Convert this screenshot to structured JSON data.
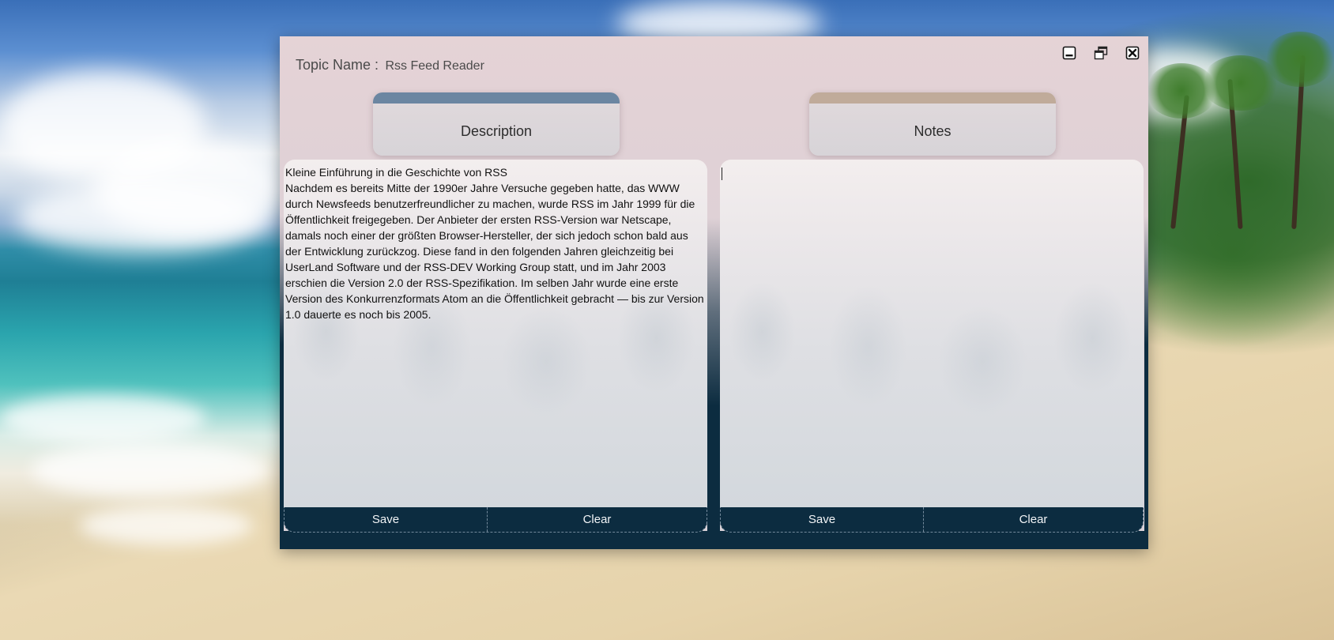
{
  "window": {
    "topic_label": "Topic Name :",
    "topic_value": "Rss Feed Reader",
    "controls": {
      "minimize_icon": "minimize-icon",
      "restore_icon": "restore-icon",
      "close_icon": "close-icon"
    }
  },
  "description": {
    "header": "Description",
    "text_lines": [
      "Kleine Einführung in die Geschichte von RSS",
      "Nachdem es bereits Mitte der 1990er Jahre Versuche gegeben hatte, das WWW durch Newsfeeds benutzerfreundlicher zu machen, wurde RSS im Jahr 1999 für die Öffentlichkeit freigegeben. Der Anbieter der ersten RSS-Version war Netscape, damals noch einer der größten Browser-Hersteller, der sich jedoch schon bald aus der Entwicklung zurückzog. Diese fand in den folgenden Jahren gleichzeitig bei UserLand Software und der RSS-DEV Working Group statt, und im Jahr 2003 erschien die Version 2.0 der RSS-Spezifikation. Im selben Jahr wurde eine erste Version des Konkurrenzformats Atom an die Öffentlichkeit gebracht — bis zur Version 1.0 dauerte es noch bis 2005."
    ],
    "save_label": "Save",
    "clear_label": "Clear"
  },
  "notes": {
    "header": "Notes",
    "text": "",
    "save_label": "Save",
    "clear_label": "Clear"
  },
  "colors": {
    "description_accent": "#6b86a1",
    "notes_accent": "#c0ab9a",
    "action_bar": "#0c2c40"
  }
}
